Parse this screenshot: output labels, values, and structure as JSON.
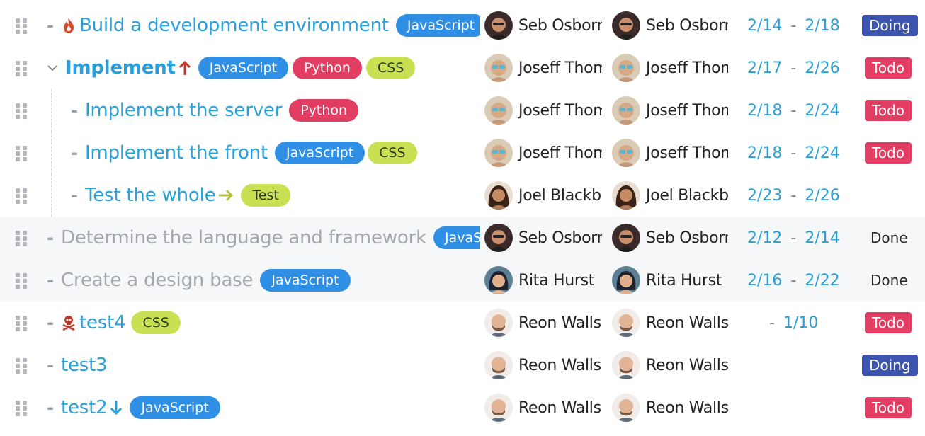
{
  "colors": {
    "accent": "#2aa0d8",
    "js": "#2e8fe4",
    "python": "#e23d62",
    "css": "#c9e052",
    "doing": "#3b55b0",
    "todo": "#e23d62"
  },
  "tasks": [
    {
      "title": "Build a development environment",
      "tags": [
        {
          "label": "JavaScript",
          "kind": "js"
        }
      ],
      "icon": "fire-icon",
      "assignee": "Seb Osborn",
      "reviewer": "Seb Osborn",
      "start": "2/14",
      "end": "2/18",
      "status": "Doing"
    },
    {
      "title": "Implement",
      "tags": [
        {
          "label": "JavaScript",
          "kind": "js"
        },
        {
          "label": "Python",
          "kind": "py"
        },
        {
          "label": "CSS",
          "kind": "css"
        }
      ],
      "icon": "arrow-up-icon",
      "assignee": "Joseff Thom",
      "reviewer": "Joseff Thom",
      "start": "2/17",
      "end": "2/26",
      "status": "Todo"
    },
    {
      "title": "Implement the server",
      "tags": [
        {
          "label": "Python",
          "kind": "py"
        }
      ],
      "assignee": "Joseff Thom",
      "reviewer": "Joseff Thom",
      "start": "2/18",
      "end": "2/24",
      "status": "Todo"
    },
    {
      "title": "Implement the front",
      "tags": [
        {
          "label": "JavaScript",
          "kind": "js"
        },
        {
          "label": "CSS",
          "kind": "css"
        }
      ],
      "assignee": "Joseff Thom",
      "reviewer": "Joseff Thom",
      "start": "2/18",
      "end": "2/24",
      "status": "Todo"
    },
    {
      "title": "Test the whole",
      "tags": [
        {
          "label": "Test",
          "kind": "test"
        }
      ],
      "icon": "arrow-right-icon",
      "assignee": "Joel Blackbu",
      "reviewer": "Joel Blackbu",
      "start": "2/23",
      "end": "2/26",
      "status": ""
    },
    {
      "title": "Determine the language and framework",
      "tags": [
        {
          "label": "JavaScr",
          "kind": "js"
        }
      ],
      "assignee": "Seb Osborn",
      "reviewer": "Seb Osborn",
      "start": "2/12",
      "end": "2/14",
      "status": "Done"
    },
    {
      "title": "Create a design base",
      "tags": [
        {
          "label": "JavaScript",
          "kind": "js"
        }
      ],
      "assignee": "Rita Hurst",
      "reviewer": "Rita Hurst",
      "start": "2/16",
      "end": "2/22",
      "status": "Done"
    },
    {
      "title": "test4",
      "tags": [
        {
          "label": "CSS",
          "kind": "css"
        }
      ],
      "icon": "skull-crossbones-icon",
      "assignee": "Reon Walls",
      "reviewer": "Reon Walls",
      "start": "",
      "end": "1/10",
      "status": "Todo"
    },
    {
      "title": "test3",
      "tags": [],
      "assignee": "Reon Walls",
      "reviewer": "Reon Walls",
      "start": "",
      "end": "",
      "status": "Doing"
    },
    {
      "title": "test2",
      "tags": [
        {
          "label": "JavaScript",
          "kind": "js"
        }
      ],
      "icon": "arrow-down-icon",
      "assignee": "Reon Walls",
      "reviewer": "Reon Walls",
      "start": "",
      "end": "",
      "status": "Todo"
    }
  ]
}
